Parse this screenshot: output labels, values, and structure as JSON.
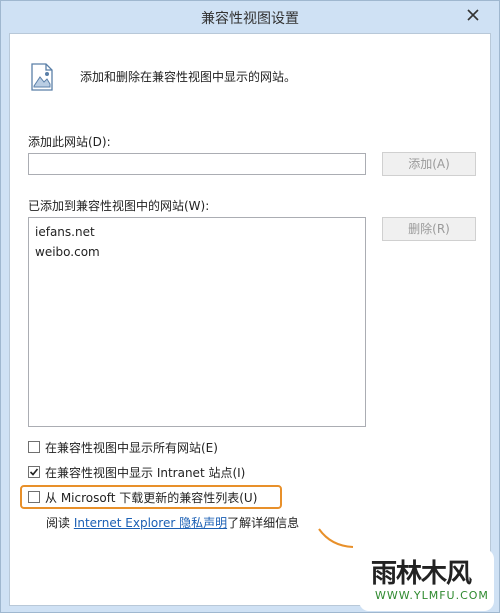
{
  "window": {
    "title": "兼容性视图设置"
  },
  "description": "添加和删除在兼容性视图中显示的网站。",
  "add_site": {
    "label": "添加此网站(D):",
    "value": "",
    "button_label": "添加(A)"
  },
  "site_list": {
    "label": "已添加到兼容性视图中的网站(W):",
    "items": [
      "iefans.net",
      "weibo.com"
    ],
    "remove_label": "删除(R)"
  },
  "options": [
    {
      "label": "在兼容性视图中显示所有网站(E)",
      "checked": false
    },
    {
      "label": "在兼容性视图中显示 Intranet 站点(I)",
      "checked": true
    },
    {
      "label": "从 Microsoft 下载更新的兼容性列表(U)",
      "checked": false
    }
  ],
  "privacy": {
    "prefix": "阅读 ",
    "link_text": "Internet Explorer 隐私声明",
    "suffix": "了解详细信息"
  },
  "watermark": {
    "main": "雨林木风",
    "url": "WWW.YLMFU.COM"
  },
  "colors": {
    "highlight": "#e8902a",
    "link": "#1a5fb4",
    "frame": "#cfe1f4"
  },
  "icons": {
    "page": "picture-icon",
    "close": "close-icon",
    "check": "checkmark-icon"
  }
}
